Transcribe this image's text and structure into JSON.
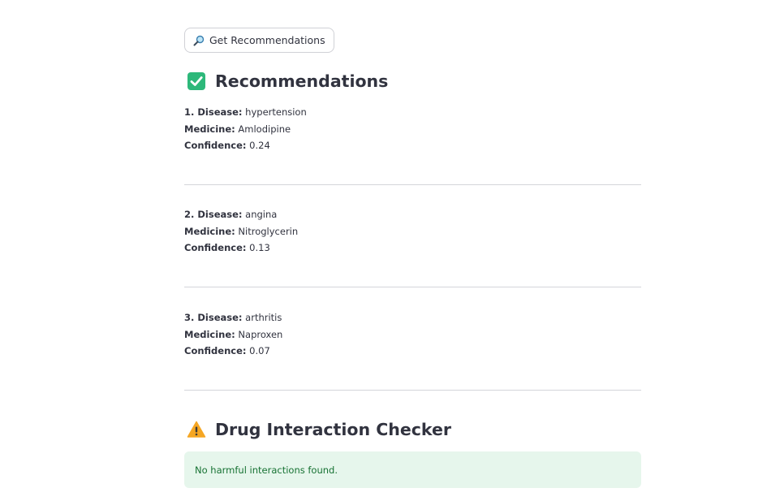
{
  "button": {
    "icon": "magnifying-glass-icon",
    "label": "Get Recommendations"
  },
  "recommendations": {
    "icon": "check-mark-button-icon",
    "title": "Recommendations",
    "items": [
      {
        "index_label": "1. Disease:",
        "disease": "hypertension",
        "medicine_label": "Medicine:",
        "medicine": "Amlodipine",
        "confidence_label": "Confidence:",
        "confidence": "0.24"
      },
      {
        "index_label": "2. Disease:",
        "disease": "angina",
        "medicine_label": "Medicine:",
        "medicine": "Nitroglycerin",
        "confidence_label": "Confidence:",
        "confidence": "0.13"
      },
      {
        "index_label": "3. Disease:",
        "disease": "arthritis",
        "medicine_label": "Medicine:",
        "medicine": "Naproxen",
        "confidence_label": "Confidence:",
        "confidence": "0.07"
      }
    ]
  },
  "interaction_checker": {
    "icon": "warning-icon",
    "title": "Drug Interaction Checker",
    "status_message": "No harmful interactions found."
  },
  "colors": {
    "success_background": "#e6f6ec",
    "success_text": "#177233",
    "check_green": "#2db87a",
    "warning_orange": "#f5a623"
  }
}
